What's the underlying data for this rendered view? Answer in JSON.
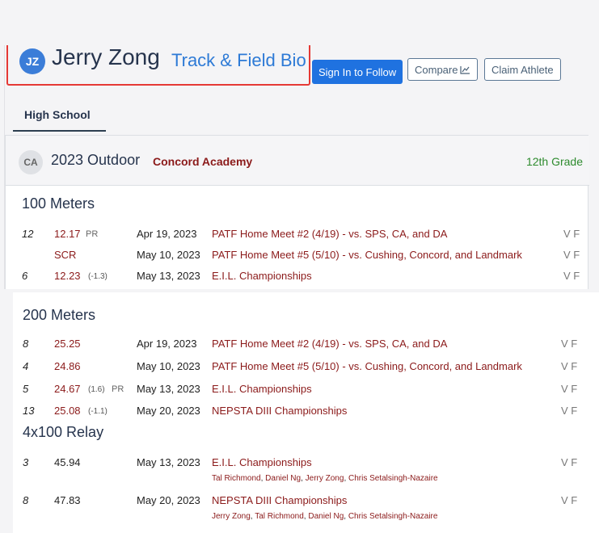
{
  "header": {
    "initials": "JZ",
    "name": "Jerry Zong",
    "bio_label": "Track & Field Bio",
    "sign_in_button": "Sign In to Follow",
    "compare_button": "Compare",
    "claim_button": "Claim Athlete"
  },
  "tabs": [
    {
      "label": "High School",
      "active": true
    }
  ],
  "season": {
    "school_initials": "CA",
    "title": "2023 Outdoor",
    "school": "Concord Academy",
    "grade": "12th Grade"
  },
  "events": [
    {
      "name": "100 Meters",
      "results": [
        {
          "place": "12",
          "mark": "12.17",
          "wind": "",
          "pr": "PR",
          "date": "Apr 19, 2023",
          "meet": "PATF Home Meet #2 (4/19) - vs. SPS, CA, and DA",
          "vf": "V F"
        },
        {
          "place": "",
          "mark": "SCR",
          "wind": "",
          "pr": "",
          "date": "May 10, 2023",
          "meet": "PATF Home Meet #5 (5/10) - vs. Cushing, Concord, and Landmark",
          "vf": "V F"
        },
        {
          "place": "6",
          "mark": "12.23",
          "wind": "(-1.3)",
          "pr": "",
          "date": "May 13, 2023",
          "meet": "E.I.L. Championships",
          "vf": "V F"
        }
      ]
    },
    {
      "name": "200 Meters",
      "results": [
        {
          "place": "8",
          "mark": "25.25",
          "wind": "",
          "pr": "",
          "date": "Apr 19, 2023",
          "meet": "PATF Home Meet #2 (4/19) - vs. SPS, CA, and DA",
          "vf": "V F"
        },
        {
          "place": "4",
          "mark": "24.86",
          "wind": "",
          "pr": "",
          "date": "May 10, 2023",
          "meet": "PATF Home Meet #5 (5/10) - vs. Cushing, Concord, and Landmark",
          "vf": "V F"
        },
        {
          "place": "5",
          "mark": "24.67",
          "wind": "(1.6)",
          "pr": "PR",
          "date": "May 13, 2023",
          "meet": "E.I.L. Championships",
          "vf": "V F"
        },
        {
          "place": "13",
          "mark": "25.08",
          "wind": "(-1.1)",
          "pr": "",
          "date": "May 20, 2023",
          "meet": "NEPSTA DIII Championships",
          "vf": "V F"
        }
      ]
    },
    {
      "name": "4x100 Relay",
      "results": [
        {
          "place": "3",
          "mark": "45.94",
          "date": "May 13, 2023",
          "meet": "E.I.L. Championships",
          "vf": "V F",
          "team": [
            "Tal Richmond",
            "Daniel Ng",
            "Jerry Zong",
            "Chris Setalsingh-Nazaire"
          ]
        },
        {
          "place": "8",
          "mark": "47.83",
          "date": "May 20, 2023",
          "meet": "NEPSTA DIII Championships",
          "vf": "V F",
          "team": [
            "Jerry Zong",
            "Tal Richmond",
            "Daniel Ng",
            "Chris Setalsingh-Nazaire"
          ]
        }
      ]
    }
  ],
  "colors": {
    "highlight_border": "#e53935",
    "primary_button": "#1f72e0",
    "mark": "#8b1a1a",
    "grade": "#2e8b2e"
  },
  "icons": {
    "compare_icon": "line-chart-icon"
  }
}
